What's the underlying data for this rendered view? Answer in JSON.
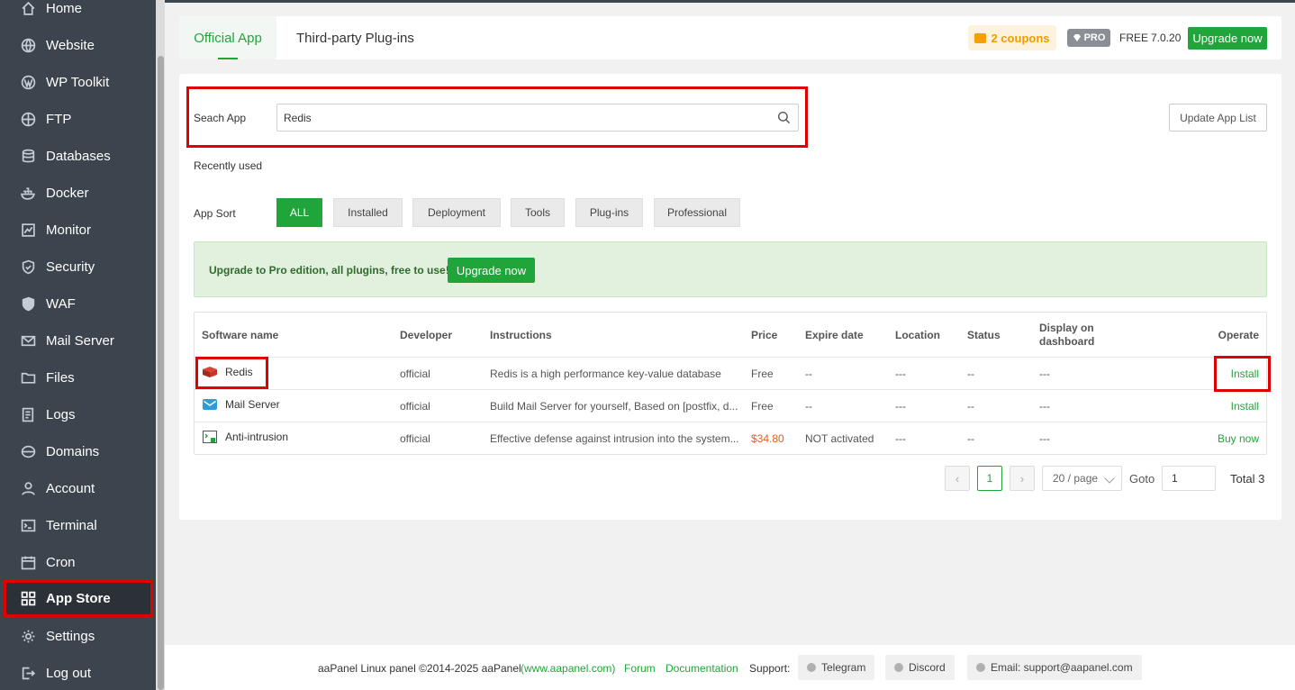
{
  "sidebar": {
    "items": [
      {
        "label": "Home",
        "icon": "home-icon"
      },
      {
        "label": "Website",
        "icon": "globe-icon"
      },
      {
        "label": "WP Toolkit",
        "icon": "wordpress-icon"
      },
      {
        "label": "FTP",
        "icon": "ftp-globe-icon"
      },
      {
        "label": "Databases",
        "icon": "database-icon"
      },
      {
        "label": "Docker",
        "icon": "docker-icon"
      },
      {
        "label": "Monitor",
        "icon": "monitor-icon"
      },
      {
        "label": "Security",
        "icon": "shield-icon"
      },
      {
        "label": "WAF",
        "icon": "waf-shield-icon"
      },
      {
        "label": "Mail Server",
        "icon": "mail-icon"
      },
      {
        "label": "Files",
        "icon": "folder-icon"
      },
      {
        "label": "Logs",
        "icon": "logs-icon"
      },
      {
        "label": "Domains",
        "icon": "domains-icon"
      },
      {
        "label": "Account",
        "icon": "user-icon"
      },
      {
        "label": "Terminal",
        "icon": "terminal-icon"
      },
      {
        "label": "Cron",
        "icon": "calendar-icon"
      },
      {
        "label": "App Store",
        "icon": "grid-icon",
        "active": true
      },
      {
        "label": "Settings",
        "icon": "gear-icon"
      },
      {
        "label": "Log out",
        "icon": "logout-icon"
      }
    ]
  },
  "header": {
    "tabs": [
      {
        "label": "Official App",
        "active": true
      },
      {
        "label": "Third-party Plug-ins",
        "active": false
      }
    ],
    "coupons": "2 coupons",
    "pro_badge": "PRO",
    "edition": "FREE",
    "version": "7.0.20",
    "upgrade_label": "Upgrade now"
  },
  "search": {
    "label": "Seach App",
    "value": "Redis",
    "placeholder": "",
    "update_button": "Update App List"
  },
  "recently_used_label": "Recently used",
  "sort": {
    "label": "App Sort",
    "options": [
      "ALL",
      "Installed",
      "Deployment",
      "Tools",
      "Plug-ins",
      "Professional"
    ],
    "selected": "ALL"
  },
  "promo": {
    "text": "Upgrade to Pro edition, all plugins, free to use!",
    "button": "Upgrade now"
  },
  "table": {
    "headers": {
      "name": "Software name",
      "developer": "Developer",
      "instructions": "Instructions",
      "price": "Price",
      "expire": "Expire date",
      "location": "Location",
      "status": "Status",
      "display_line1": "Display on",
      "display_line2": "dashboard",
      "operate": "Operate"
    },
    "rows": [
      {
        "name": "Redis",
        "icon": "redis-icon",
        "developer": "official",
        "instructions": "Redis is a high performance key-value database",
        "price": "Free",
        "expire": "--",
        "location": "---",
        "status": "--",
        "display": "---",
        "operate": "Install"
      },
      {
        "name": "Mail Server",
        "icon": "mail-app-icon",
        "developer": "official",
        "instructions": "Build Mail Server for yourself, Based on [postfix, d...",
        "price": "Free",
        "expire": "--",
        "location": "---",
        "status": "--",
        "display": "---",
        "operate": "Install"
      },
      {
        "name": "Anti-intrusion",
        "icon": "anti-intrusion-icon",
        "developer": "official",
        "instructions": "Effective defense against intrusion into the system...",
        "price": "$34.80",
        "expire": "NOT activated",
        "location": "---",
        "status": "--",
        "display": "---",
        "operate": "Buy now"
      }
    ]
  },
  "pagination": {
    "prev": "‹",
    "next": "›",
    "current": "1",
    "page_size": "20 / page",
    "goto_label": "Goto",
    "goto_value": "1",
    "total": "Total 3"
  },
  "footer": {
    "copyright": "aaPanel Linux panel ©2014-2025 aaPanel",
    "site_link": "(www.aapanel.com)",
    "forum": "Forum",
    "documentation": "Documentation",
    "support_label": "Support:",
    "telegram": "Telegram",
    "discord": "Discord",
    "email": "Email: support@aapanel.com"
  },
  "colors": {
    "accent": "#20a53a",
    "sidebar_bg": "#3c444d",
    "highlight": "#e00000",
    "price_paid": "#e35d1a"
  }
}
